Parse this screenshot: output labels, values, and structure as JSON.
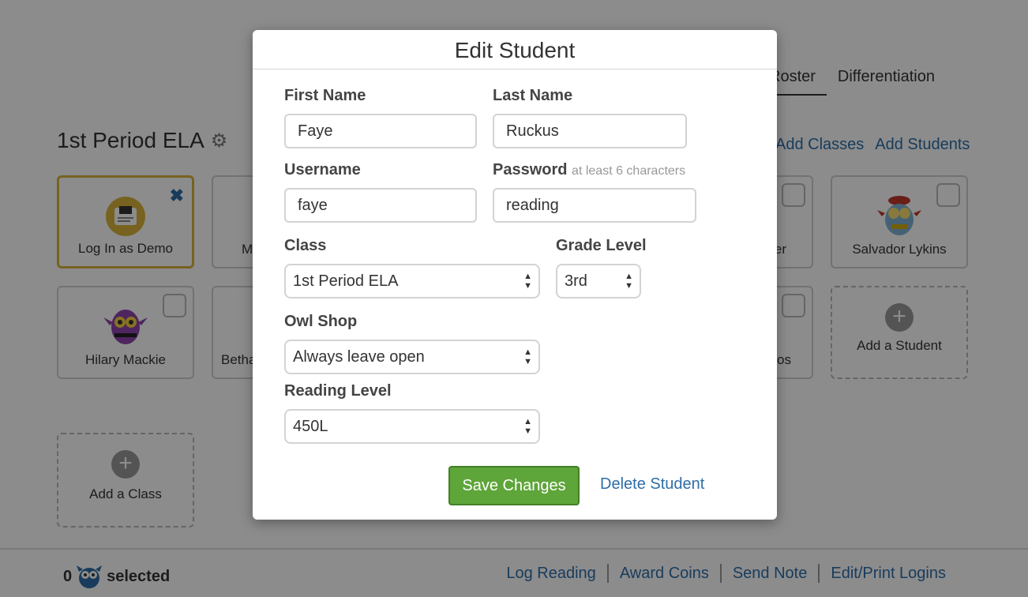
{
  "tabs": [
    "Roster",
    "Differentiation"
  ],
  "class_title": "1st Period ELA",
  "top_links": {
    "add_classes": "Add Classes",
    "add_students": "Add Students"
  },
  "cards": {
    "demo": "Log In as Demo",
    "partial_m": "M",
    "partial_er": "er",
    "salvador": "Salvador Lykins",
    "hilary": "Hilary Mackie",
    "partial_betha": "Betha",
    "partial_os": "os",
    "add_student": "Add a Student",
    "add_class": "Add a Class"
  },
  "footer": {
    "selected_count": "0",
    "selected_label": "selected",
    "links": [
      "Log Reading",
      "Award Coins",
      "Send Note",
      "Edit/Print Logins"
    ]
  },
  "modal": {
    "title": "Edit Student",
    "first_name_label": "First Name",
    "first_name_value": "Faye",
    "last_name_label": "Last Name",
    "last_name_value": "Ruckus",
    "username_label": "Username",
    "username_value": "faye",
    "password_label": "Password",
    "password_hint": "at least 6 characters",
    "password_value": "reading",
    "class_label": "Class",
    "class_value": "1st Period ELA",
    "grade_label": "Grade Level",
    "grade_value": "3rd",
    "owl_shop_label": "Owl Shop",
    "owl_shop_value": "Always leave open",
    "reading_level_label": "Reading Level",
    "reading_level_value": "450L",
    "save_label": "Save Changes",
    "delete_label": "Delete Student"
  },
  "colors": {
    "link": "#2e6ea8",
    "save_button": "#5ea53a",
    "demo_border": "#d9b33b"
  }
}
